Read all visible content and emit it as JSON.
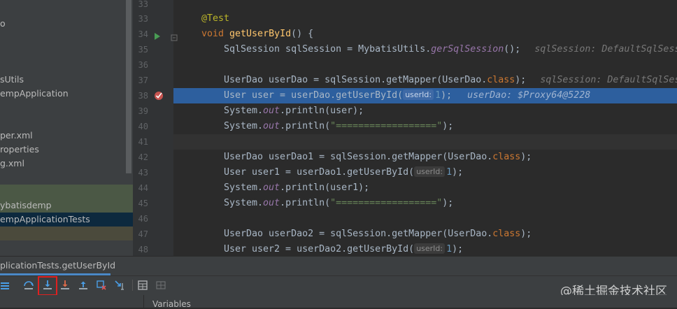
{
  "project_tree": {
    "items": [
      {
        "label": "o"
      },
      {
        "label": "sUtils"
      },
      {
        "label": "empApplication"
      },
      {
        "label": "per.xml"
      },
      {
        "label": "roperties"
      },
      {
        "label": "g.xml"
      },
      {
        "label": "ybatisdemp"
      },
      {
        "label": "empApplicationTests"
      }
    ]
  },
  "editor": {
    "lines": [
      {
        "n": "33",
        "text": "@Test"
      },
      {
        "n": "34",
        "kw": "void ",
        "fn": "getUserById",
        "rest": "() {"
      },
      {
        "n": "35",
        "code": "SqlSession sqlSession = MybatisUtils.",
        "it": "gerSqlSession",
        "tail": "();",
        "hint": "sqlSession: DefaultSqlSession@..."
      },
      {
        "n": "36"
      },
      {
        "n": "37",
        "code": "UserDao userDao = sqlSession.getMapper(UserDao.",
        "kwt": "class",
        "tail": ");",
        "hint": "sqlSession: DefaultSqlSession@..."
      },
      {
        "n": "38",
        "code": "User user = userDao.getUserById(",
        "ph": "userId:",
        "num": "1",
        "tail": ");",
        "hint": "userDao: $Proxy64@5228"
      },
      {
        "n": "39",
        "code": "System.",
        "it": "out",
        "tail": ".println(user);"
      },
      {
        "n": "40",
        "code": "System.",
        "it": "out",
        "tail": ".println(",
        "str": "\"==================\"",
        "end": ");"
      },
      {
        "n": "41"
      },
      {
        "n": "42",
        "code": "UserDao userDao1 = sqlSession.getMapper(UserDao.",
        "kwt": "class",
        "tail": ");"
      },
      {
        "n": "43",
        "code": "User user1 = userDao1.getUserById(",
        "ph": "userId:",
        "num": "1",
        "tail": ");"
      },
      {
        "n": "44",
        "code": "System.",
        "it": "out",
        "tail": ".println(user1);"
      },
      {
        "n": "45",
        "code": "System.",
        "it": "out",
        "tail": ".println(",
        "str": "\"==================\"",
        "end": ");"
      },
      {
        "n": "46"
      },
      {
        "n": "47",
        "code": "UserDao userDao2 = sqlSession.getMapper(UserDao.",
        "kwt": "class",
        "tail": ");"
      },
      {
        "n": "48",
        "code": "User user2 = userDao2.getUserById(",
        "ph": "userId:",
        "num": "1",
        "tail": ");"
      }
    ]
  },
  "debug": {
    "tab_label": "plicationTests.getUserById",
    "variables_label": "Variables"
  },
  "watermark": "@稀土掘金技术社区"
}
